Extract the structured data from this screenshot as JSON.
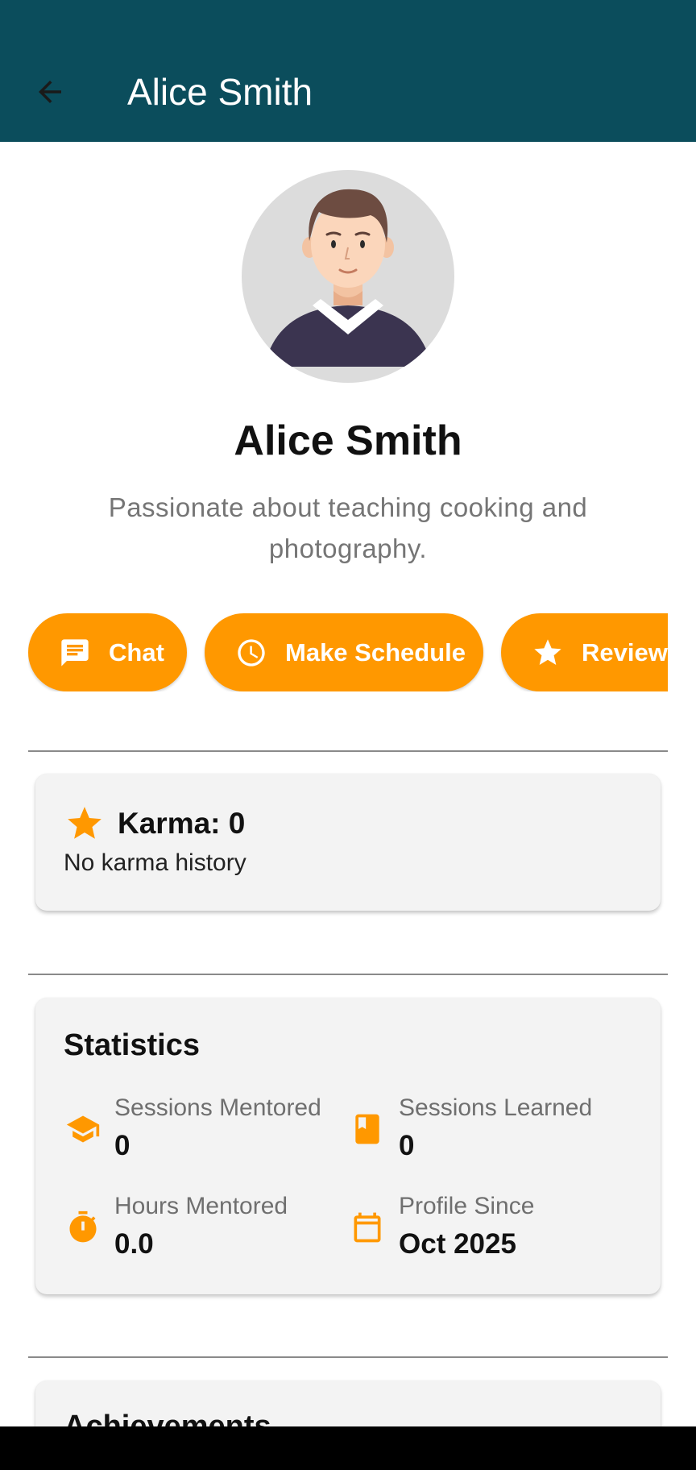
{
  "appbar": {
    "title": "Alice Smith",
    "back_icon": "arrow-back-icon",
    "background": "#0b4d5c"
  },
  "profile": {
    "name": "Alice Smith",
    "bio": "Passionate about teaching cooking and photography."
  },
  "actions": [
    {
      "label": "Chat",
      "icon": "chat-icon"
    },
    {
      "label": "Make Schedule",
      "icon": "clock-icon"
    },
    {
      "label": "Reviews",
      "icon": "star-icon"
    }
  ],
  "karma": {
    "title": "Karma: 0",
    "history": "No karma history",
    "icon": "star-icon"
  },
  "statistics": {
    "title": "Statistics",
    "items": [
      {
        "label": "Sessions Mentored",
        "value": "0",
        "icon": "school-icon"
      },
      {
        "label": "Sessions Learned",
        "value": "0",
        "icon": "book-icon"
      },
      {
        "label": "Hours Mentored",
        "value": "0.0",
        "icon": "timer-icon"
      },
      {
        "label": "Profile Since",
        "value": "Oct 2025",
        "icon": "calendar-icon"
      }
    ]
  },
  "achievements": {
    "title": "Achievements"
  },
  "colors": {
    "accent": "#ff9800",
    "header": "#0b4d5c",
    "card": "#f3f3f3"
  }
}
